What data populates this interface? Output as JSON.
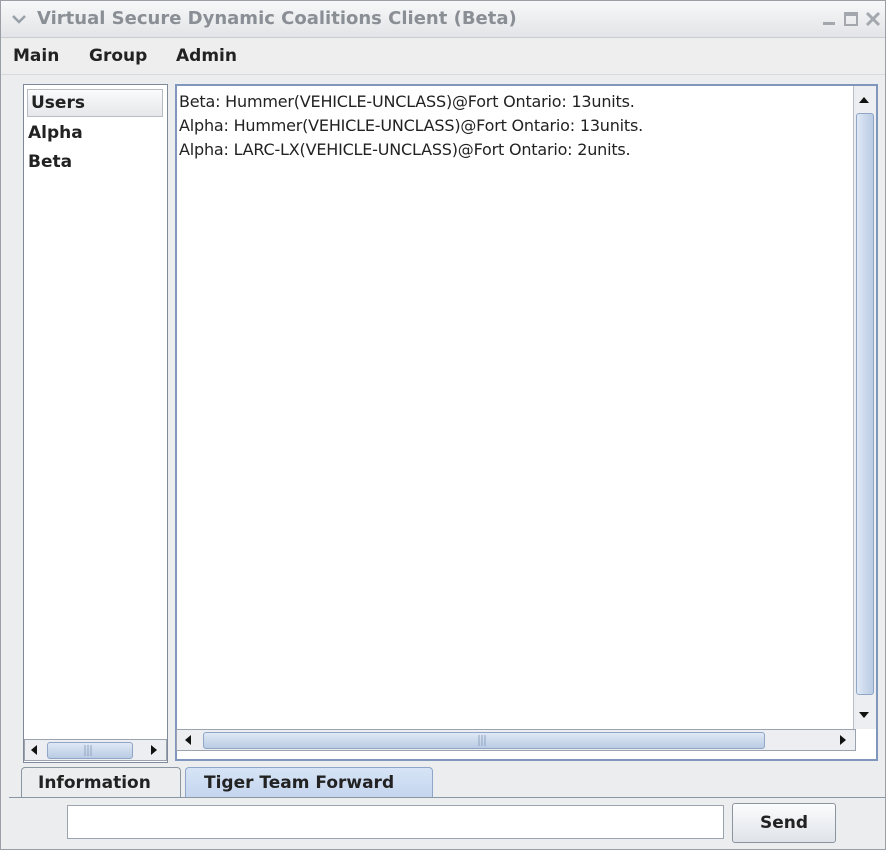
{
  "window": {
    "title": "Virtual Secure Dynamic Coalitions Client (Beta)"
  },
  "menu": [
    "Main",
    "Group",
    "Admin"
  ],
  "users_list": {
    "header": "Users",
    "items": [
      "Alpha",
      "Beta"
    ]
  },
  "messages": [
    "Beta: Hummer(VEHICLE-UNCLASS)@Fort Ontario: 13units.",
    "Alpha: Hummer(VEHICLE-UNCLASS)@Fort Ontario: 13units.",
    "Alpha: LARC-LX(VEHICLE-UNCLASS)@Fort Ontario: 2units."
  ],
  "tabs": [
    "Information",
    "Tiger Team Forward"
  ],
  "input": {
    "value": "",
    "placeholder": ""
  },
  "send_label": "Send",
  "colors": {
    "accent": "#c4d5ee",
    "border": "#7f97bd"
  }
}
